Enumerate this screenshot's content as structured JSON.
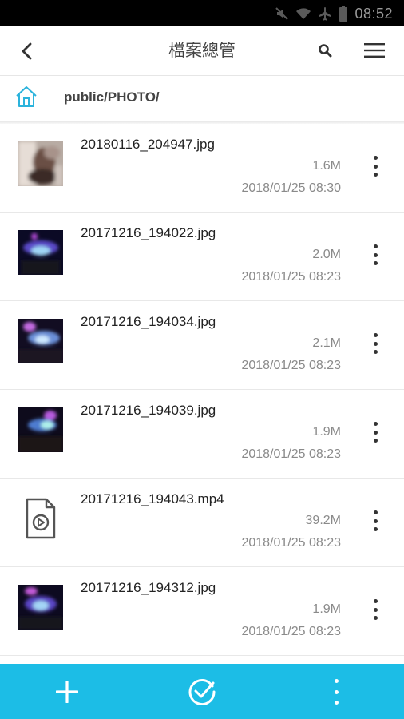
{
  "status_bar": {
    "time": "08:52",
    "icons": [
      "mute-icon",
      "wifi-icon",
      "airplane-icon",
      "battery-icon"
    ]
  },
  "app_bar": {
    "title": "檔案總管",
    "back_icon": "chevron-left-icon",
    "search_icon": "search-icon",
    "menu_icon": "hamburger-menu-icon"
  },
  "path_bar": {
    "home_icon": "home-icon",
    "path": "public/PHOTO/"
  },
  "files": [
    {
      "name": "20180116_204947.jpg",
      "size": "1.6M",
      "date": "2018/01/25 08:30",
      "type": "image"
    },
    {
      "name": "20171216_194022.jpg",
      "size": "2.0M",
      "date": "2018/01/25 08:23",
      "type": "image"
    },
    {
      "name": "20171216_194034.jpg",
      "size": "2.1M",
      "date": "2018/01/25 08:23",
      "type": "image"
    },
    {
      "name": "20171216_194039.jpg",
      "size": "1.9M",
      "date": "2018/01/25 08:23",
      "type": "image"
    },
    {
      "name": "20171216_194043.mp4",
      "size": "39.2M",
      "date": "2018/01/25 08:23",
      "type": "video"
    },
    {
      "name": "20171216_194312.jpg",
      "size": "1.9M",
      "date": "2018/01/25 08:23",
      "type": "image"
    }
  ],
  "bottom_bar": {
    "color": "#1cbde6",
    "actions": [
      "add-icon",
      "select-check-icon",
      "more-vertical-icon"
    ]
  }
}
